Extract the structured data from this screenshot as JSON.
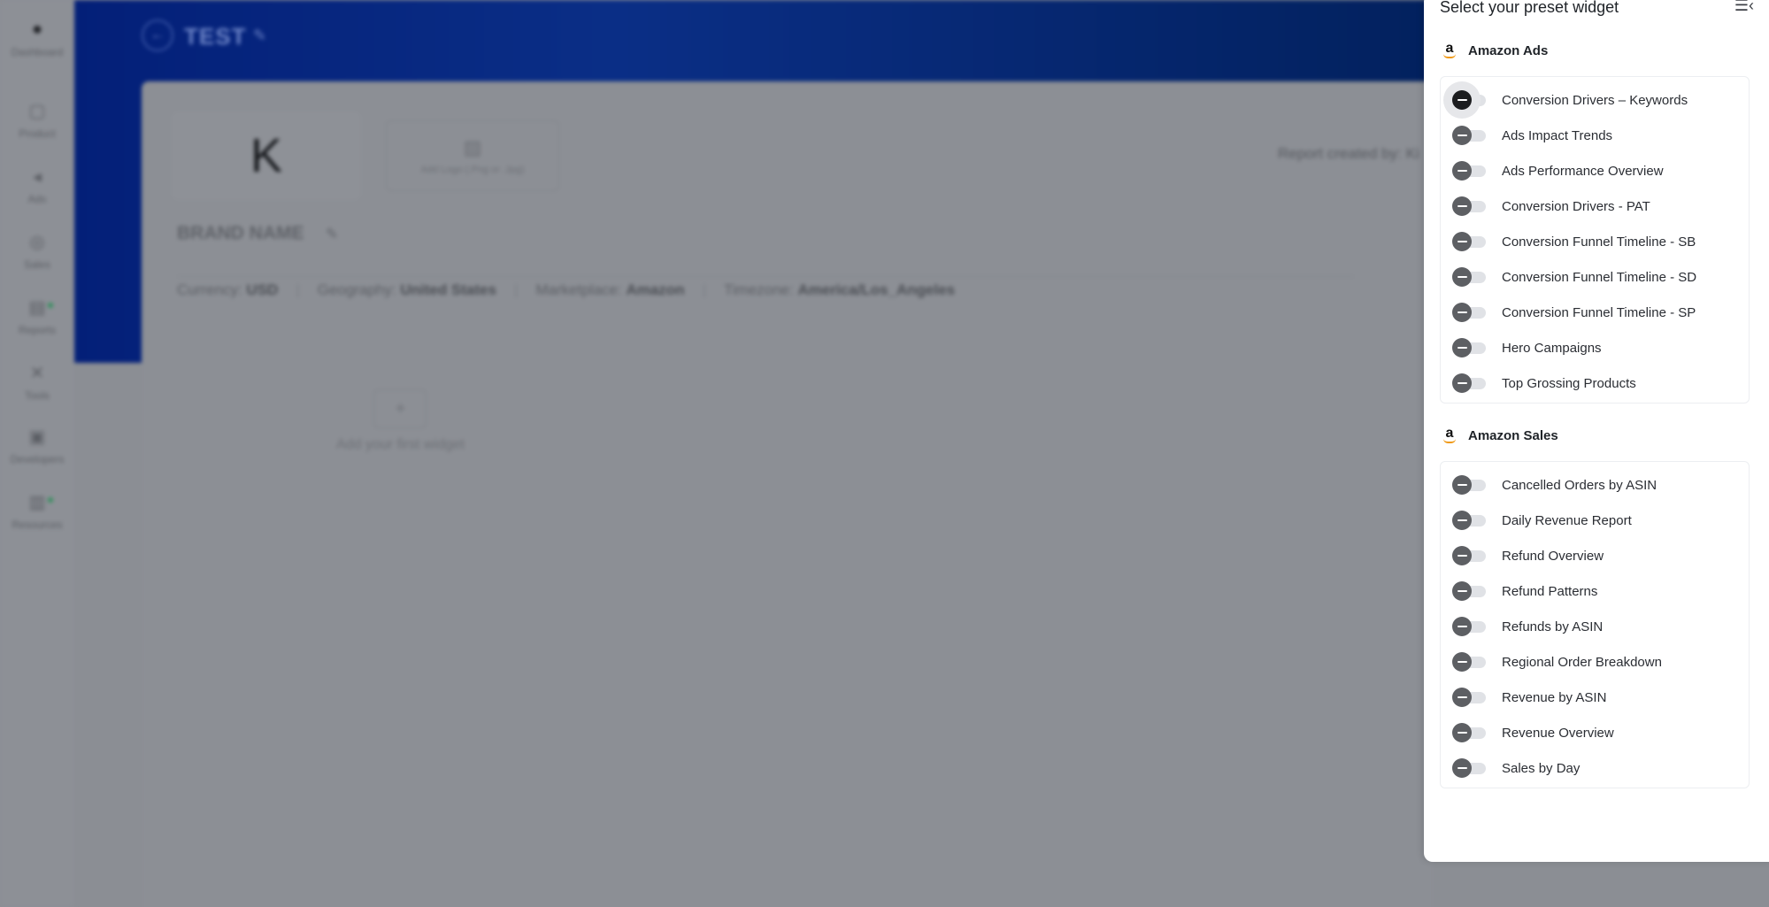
{
  "app": {
    "sidebar": [
      {
        "label": "Dashboard",
        "icon": "logo-icon"
      },
      {
        "label": "Product",
        "icon": "box-icon"
      },
      {
        "label": "Ads",
        "icon": "megaphone-icon"
      },
      {
        "label": "Sales",
        "icon": "dollar-icon"
      },
      {
        "label": "Reports",
        "icon": "report-icon"
      },
      {
        "label": "Tools",
        "icon": "tools-icon"
      },
      {
        "label": "Developers",
        "icon": "code-icon"
      },
      {
        "label": "Resources",
        "icon": "book-icon"
      }
    ],
    "report_title": "TEST",
    "brand_initial": "K",
    "upload_hint": "Add Logo (.Png or .Jpg)",
    "report_created_by": "Report created by: Ki",
    "brand_name": "BRAND NAME",
    "meta": {
      "currency_label": "Currency:",
      "currency": "USD",
      "geography_label": "Geography:",
      "geography": "United States",
      "marketplace_label": "Marketplace:",
      "marketplace": "Amazon",
      "timezone_label": "Timezone:",
      "timezone": "America/Los_Angeles"
    },
    "add_widget": "Add your first widget"
  },
  "panel": {
    "title": "Select your preset widget",
    "sections": [
      {
        "name": "Amazon Ads",
        "widgets": [
          "Conversion Drivers – Keywords",
          "Ads Impact Trends",
          "Ads Performance Overview",
          "Conversion Drivers - PAT",
          "Conversion Funnel Timeline - SB",
          "Conversion Funnel Timeline - SD",
          "Conversion Funnel Timeline - SP",
          "Hero Campaigns",
          "Top Grossing Products"
        ]
      },
      {
        "name": "Amazon Sales",
        "widgets": [
          "Cancelled Orders by ASIN",
          "Daily Revenue Report",
          "Refund Overview",
          "Refund Patterns",
          "Refunds by ASIN",
          "Regional Order Breakdown",
          "Revenue by ASIN",
          "Revenue Overview",
          "Sales by Day"
        ]
      }
    ]
  }
}
